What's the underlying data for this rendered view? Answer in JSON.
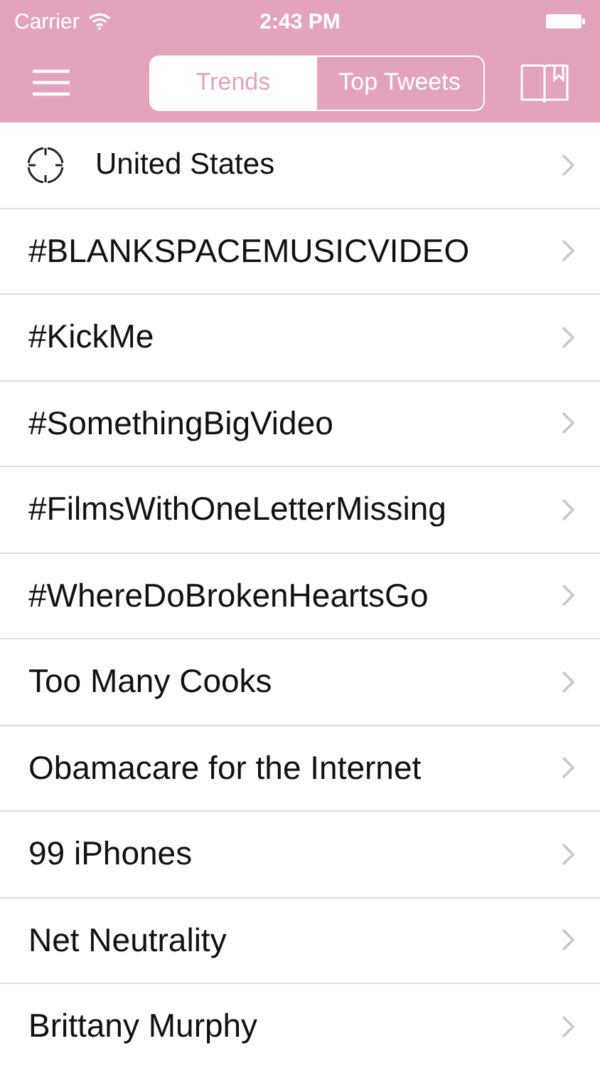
{
  "status_bar": {
    "carrier": "Carrier",
    "time": "2:43 PM"
  },
  "tabs": [
    {
      "label": "Trends",
      "selected": true
    },
    {
      "label": "Top Tweets",
      "selected": false
    }
  ],
  "location": {
    "label": "United States"
  },
  "trends": [
    "#BLANKSPACEMUSICVIDEO",
    "#KickMe",
    "#SomethingBigVideo",
    "#FilmsWithOneLetterMissing",
    "#WhereDoBrokenHeartsGo",
    "Too Many Cooks",
    "Obamacare for the Internet",
    "99 iPhones",
    "Net Neutrality",
    "Brittany Murphy"
  ]
}
